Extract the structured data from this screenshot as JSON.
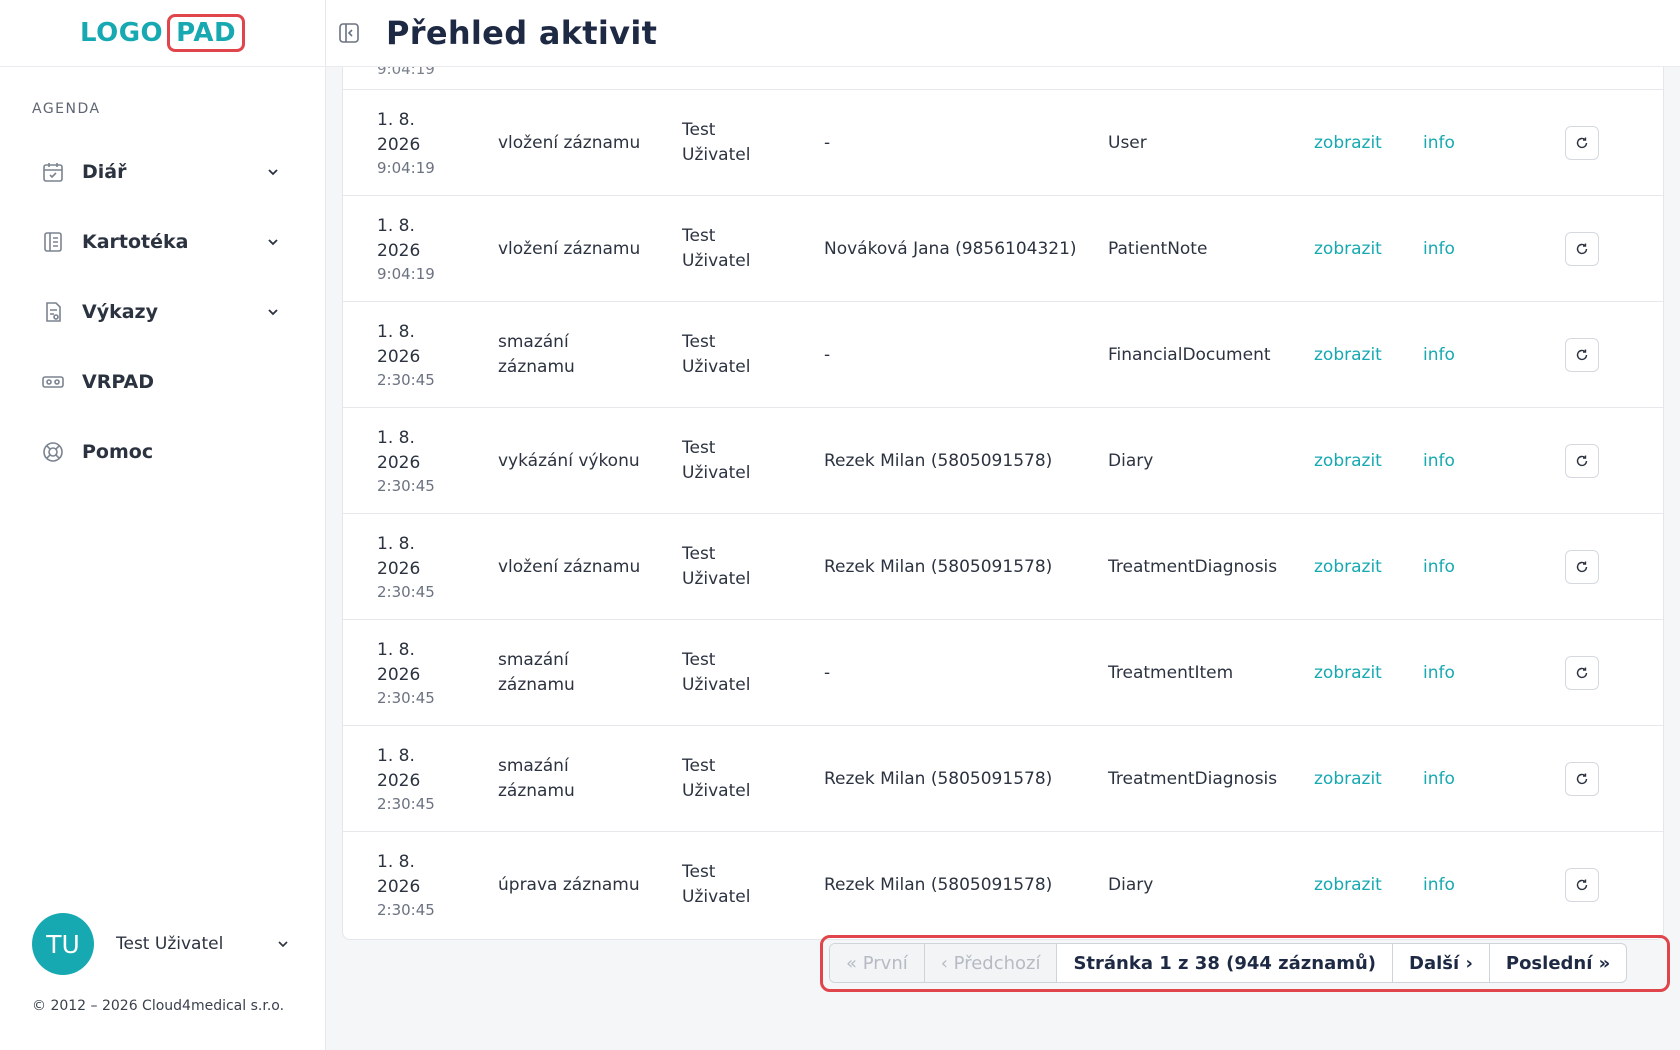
{
  "logo": {
    "part1": "LOGO",
    "part2": "PAD"
  },
  "sidebar": {
    "section": "AGENDA",
    "items": [
      {
        "label": "Diář",
        "icon": "calendar-icon",
        "expandable": true
      },
      {
        "label": "Kartotéka",
        "icon": "card-index-icon",
        "expandable": true
      },
      {
        "label": "Výkazy",
        "icon": "report-icon",
        "expandable": true
      },
      {
        "label": "VRPAD",
        "icon": "vr-headset-icon",
        "expandable": false
      },
      {
        "label": "Pomoc",
        "icon": "lifebuoy-icon",
        "expandable": false
      }
    ],
    "user": {
      "initials": "TU",
      "name": "Test Uživatel"
    },
    "copyright": "© 2012 – 2026 Cloud4medical s.r.o."
  },
  "header": {
    "title": "Přehled aktivit"
  },
  "table": {
    "partial_row_text": "9:04:19",
    "rows": [
      {
        "date": "1. 8.",
        "year": "2026",
        "time": "9:04:19",
        "action": "vložení záznamu",
        "user1": "Test",
        "user2": "Uživatel",
        "patient": "-",
        "entity": "User",
        "show": "zobrazit",
        "info": "info"
      },
      {
        "date": "1. 8.",
        "year": "2026",
        "time": "9:04:19",
        "action": "vložení záznamu",
        "user1": "Test",
        "user2": "Uživatel",
        "patient": "Nováková Jana (9856104321)",
        "entity": "PatientNote",
        "show": "zobrazit",
        "info": "info"
      },
      {
        "date": "1. 8.",
        "year": "2026",
        "time": "2:30:45",
        "action": "smazání záznamu",
        "user1": "Test",
        "user2": "Uživatel",
        "patient": "-",
        "entity": "FinancialDocument",
        "show": "zobrazit",
        "info": "info"
      },
      {
        "date": "1. 8.",
        "year": "2026",
        "time": "2:30:45",
        "action": "vykázání výkonu",
        "user1": "Test",
        "user2": "Uživatel",
        "patient": "Rezek Milan (5805091578)",
        "entity": "Diary",
        "show": "zobrazit",
        "info": "info"
      },
      {
        "date": "1. 8.",
        "year": "2026",
        "time": "2:30:45",
        "action": "vložení záznamu",
        "user1": "Test",
        "user2": "Uživatel",
        "patient": "Rezek Milan (5805091578)",
        "entity": "TreatmentDiagnosis",
        "show": "zobrazit",
        "info": "info"
      },
      {
        "date": "1. 8.",
        "year": "2026",
        "time": "2:30:45",
        "action": "smazání záznamu",
        "user1": "Test",
        "user2": "Uživatel",
        "patient": "-",
        "entity": "TreatmentItem",
        "show": "zobrazit",
        "info": "info"
      },
      {
        "date": "1. 8.",
        "year": "2026",
        "time": "2:30:45",
        "action": "smazání záznamu",
        "user1": "Test",
        "user2": "Uživatel",
        "patient": "Rezek Milan (5805091578)",
        "entity": "TreatmentDiagnosis",
        "show": "zobrazit",
        "info": "info"
      },
      {
        "date": "1. 8.",
        "year": "2026",
        "time": "2:30:45",
        "action": "úprava záznamu",
        "user1": "Test",
        "user2": "Uživatel",
        "patient": "Rezek Milan (5805091578)",
        "entity": "Diary",
        "show": "zobrazit",
        "info": "info"
      }
    ]
  },
  "pagination": {
    "first": "« První",
    "prev": "‹ Předchozí",
    "status": "Stránka 1 z 38 (944 záznamů)",
    "next": "Další ›",
    "last": "Poslední »"
  },
  "colors": {
    "accent": "#17a9b2",
    "highlight": "#e0454b"
  }
}
